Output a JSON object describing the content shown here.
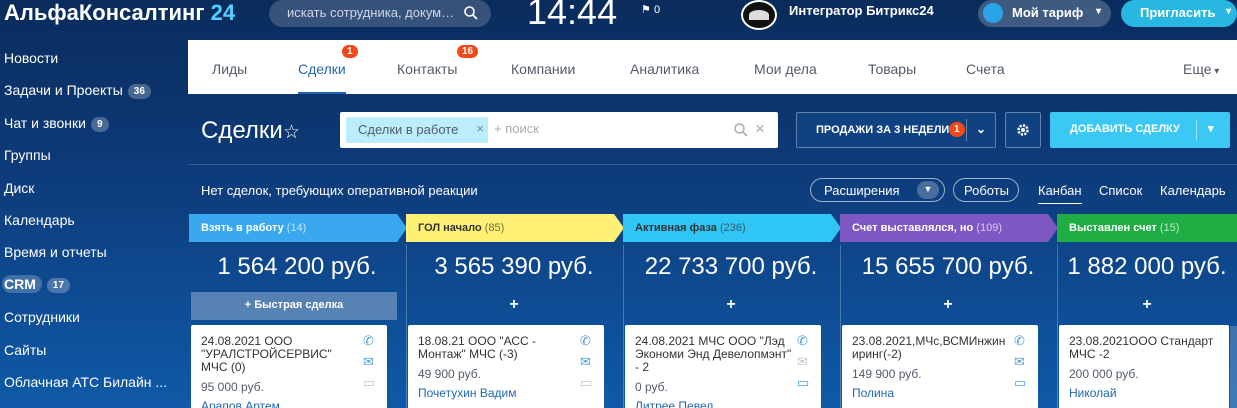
{
  "app": {
    "logo_main": "АльфаКонсалтинг",
    "logo_num": "24",
    "search_placeholder": "искать сотрудника, докум…",
    "clock": "14:44",
    "flag_count": "0",
    "profile_name": "Интегратор Битрикс24",
    "tariff_label": "Мой тариф",
    "invite_label": "Пригласить"
  },
  "sidebar": {
    "items": [
      {
        "label": "Новости",
        "count": ""
      },
      {
        "label": "Задачи и Проекты",
        "count": "36"
      },
      {
        "label": "Чат и звонки",
        "count": "9"
      },
      {
        "label": "Группы",
        "count": ""
      },
      {
        "label": "Диск",
        "count": ""
      },
      {
        "label": "Календарь",
        "count": ""
      },
      {
        "label": "Время и отчеты",
        "count": ""
      },
      {
        "label": "CRM",
        "count": "17"
      },
      {
        "label": "Сотрудники",
        "count": ""
      },
      {
        "label": "Сайты",
        "count": ""
      },
      {
        "label": "Облачная АТС Билайн ...",
        "count": ""
      }
    ]
  },
  "nav": {
    "tabs": [
      {
        "label": "Лиды",
        "badge": ""
      },
      {
        "label": "Сделки",
        "badge": "1"
      },
      {
        "label": "Контакты",
        "badge": "16"
      },
      {
        "label": "Компании",
        "badge": ""
      },
      {
        "label": "Аналитика",
        "badge": ""
      },
      {
        "label": "Мои дела",
        "badge": ""
      },
      {
        "label": "Товары",
        "badge": ""
      },
      {
        "label": "Счета",
        "badge": ""
      },
      {
        "label": "Еще",
        "badge": ""
      }
    ]
  },
  "toolbar": {
    "page_title": "Сделки",
    "filter_chip": "Сделки в работе",
    "filter_placeholder": "+ поиск",
    "preset_label": "ПРОДАЖИ ЗА 3 НЕДЕЛИ",
    "preset_badge": "1",
    "add_label": "ДОБАВИТЬ СДЕЛКУ"
  },
  "subbar": {
    "no_reaction": "Нет сделок, требующих оперативной реакции",
    "extensions": "Расширения",
    "robots": "Роботы",
    "views": [
      "Канбан",
      "Список",
      "Календарь"
    ]
  },
  "colors": {
    "stage_1": "#39a8ef",
    "stage_2": "#fff176",
    "stage_3": "#2fc6f6",
    "stage_4": "#7e57c2",
    "stage_5": "#1eae43"
  },
  "kanban": {
    "quick_deal": "+ Быстрая сделка",
    "plus": "+",
    "columns": [
      {
        "name": "Взять в работу",
        "count": "(14)",
        "sum": "1 564 200 руб.",
        "card": {
          "title": "24.08.2021 ООО \"УРАЛСТРОЙСЕРВИС\" МЧС (0)",
          "sum": "95 000 руб.",
          "contact": "Арапов Артем"
        }
      },
      {
        "name": "ГОЛ начало",
        "count": "(85)",
        "sum": "3 565 390 руб.",
        "card": {
          "title": "18.08.21 ООО \"АСС - Монтаж\" МЧС (-3)",
          "sum": "49 900 руб.",
          "contact": "Почетухин Вадим"
        }
      },
      {
        "name": "Активная фаза",
        "count": "(236)",
        "sum": "22 733 700 руб.",
        "card": {
          "title": "24.08.2021 МЧС ООО \"Лэд Экономи Энд Девелопмэнт\" - 2",
          "sum": "0 руб.",
          "contact": "Литрее Певел"
        }
      },
      {
        "name": "Счет выставлялся, но",
        "count": "(109)",
        "sum": "15 655 700 руб.",
        "card": {
          "title": "23.08.2021,МЧс,ВСМИнжин иринг(-2)",
          "sum": "149 900 руб.",
          "contact": "Полина"
        }
      },
      {
        "name": "Выставлен счет",
        "count": "(15)",
        "sum": "1 882 000 руб.",
        "card": {
          "title": "23.08.2021ООО Стандарт МЧС -2",
          "sum": "200 000 руб.",
          "contact": "Николай"
        }
      }
    ]
  }
}
